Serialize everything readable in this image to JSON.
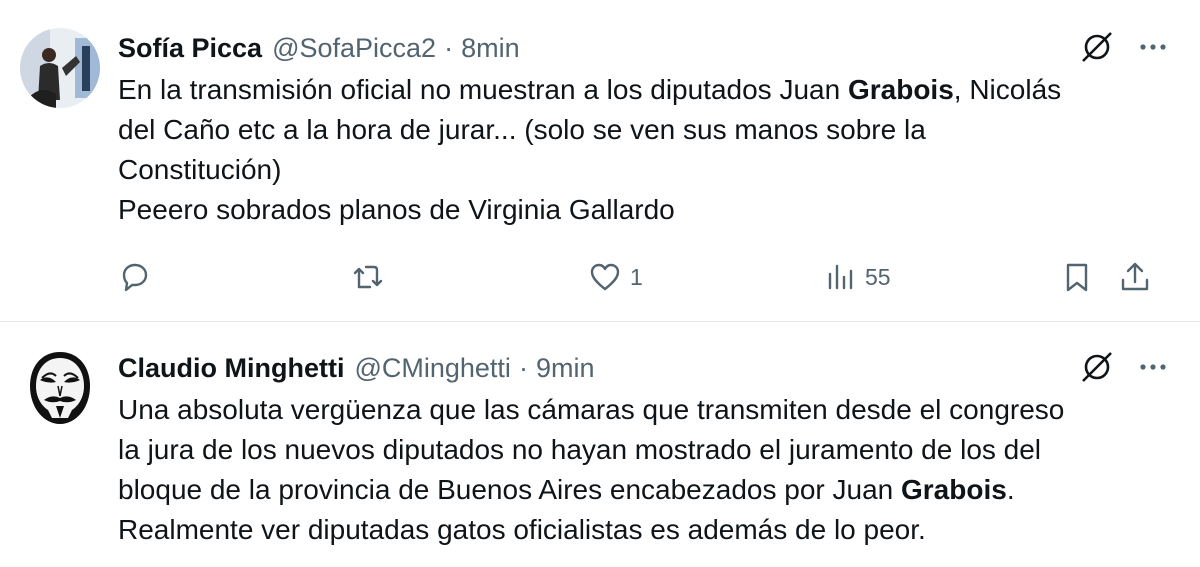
{
  "tweets": [
    {
      "author_name": "Sofía Picca",
      "handle": "@SofaPicca2",
      "separator": "·",
      "time": "8min",
      "text_lines": [
        [
          "En la transmisión oficial no muestran a los diputados Juan ",
          "Grabois",
          ", Nicolás"
        ],
        [
          "del Caño etc a la hora de jurar... (solo se ven sus manos sobre la"
        ],
        [
          "Constitución)"
        ],
        [
          "Peeero sobrados planos de Virginia Gallardo"
        ]
      ],
      "likes": "1",
      "views": "55"
    },
    {
      "author_name": "Claudio Minghetti",
      "handle": "@CMinghetti",
      "separator": "·",
      "time": "9min",
      "text_lines": [
        [
          "Una absoluta vergüenza que las cámaras que transmiten desde el congreso"
        ],
        [
          "la jura de los nuevos diputados no hayan mostrado el juramento de los del"
        ],
        [
          "bloque de la provincia de Buenos Aires encabezados por Juan ",
          "Grabois",
          "."
        ],
        [
          "Realmente ver diputadas gatos oficialistas es además de lo peor."
        ]
      ]
    }
  ],
  "icons": {
    "grok": "grok-icon",
    "more": "more-icon",
    "reply": "reply-icon",
    "retweet": "retweet-icon",
    "like": "heart-icon",
    "views": "views-icon",
    "bookmark": "bookmark-icon",
    "share": "share-icon"
  },
  "colors": {
    "text": "#0f1419",
    "secondary": "#536471",
    "divider": "#e8eaed"
  }
}
